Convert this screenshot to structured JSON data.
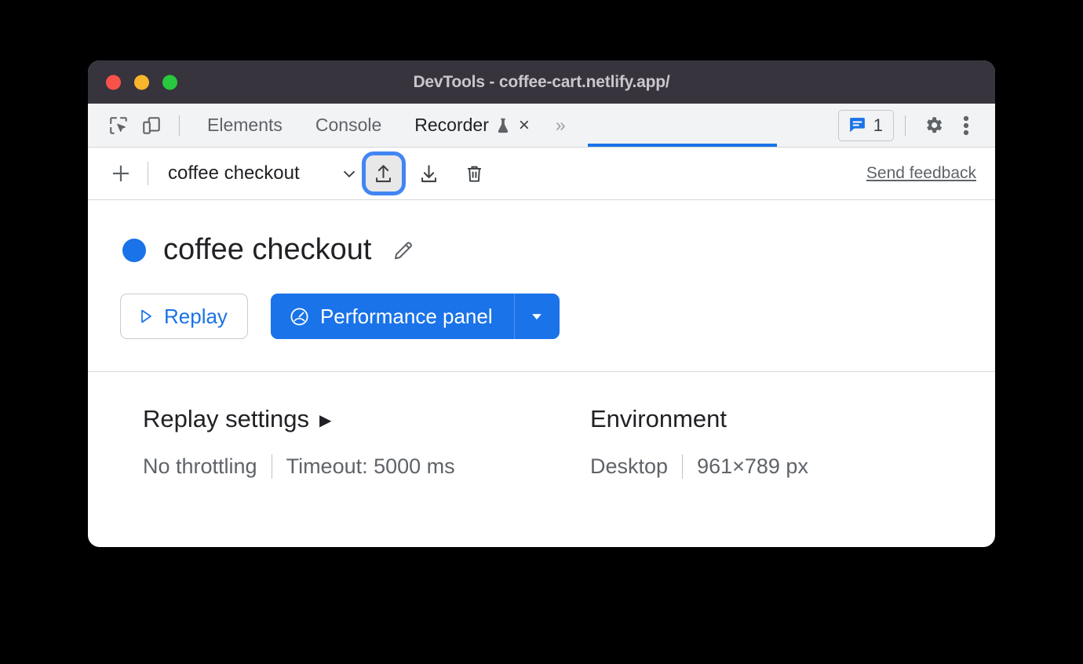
{
  "window": {
    "title": "DevTools - coffee-cart.netlify.app/",
    "traffic_lights": [
      "close",
      "minimize",
      "maximize"
    ]
  },
  "tabbar": {
    "left_icons": [
      {
        "name": "inspect-element-icon"
      },
      {
        "name": "device-toolbar-icon"
      }
    ],
    "tabs": [
      {
        "label": "Elements",
        "active": false
      },
      {
        "label": "Console",
        "active": false
      },
      {
        "label": "Recorder",
        "active": true,
        "experimental": true,
        "closable": true
      }
    ],
    "tab_close_glyph": "×",
    "overflow_glyph": "»",
    "issues_count": "1",
    "right_icons": [
      {
        "name": "settings-gear-icon"
      },
      {
        "name": "more-options-icon"
      }
    ],
    "active_tab_accent": "#1a73e8"
  },
  "recorder_toolbar": {
    "add_recording_label": "+",
    "recording_name": "coffee checkout",
    "chevron_glyph": "⌄",
    "buttons": [
      {
        "name": "export-recording",
        "highlighted": true
      },
      {
        "name": "import-recording",
        "highlighted": false
      },
      {
        "name": "delete-recording",
        "highlighted": false
      }
    ],
    "feedback_label": "Send feedback",
    "highlight_ring_color": "#4285f4",
    "highlight_fill_color": "#e8e8e8"
  },
  "recording": {
    "status_color": "#1a73e8",
    "title": "coffee checkout",
    "edit_icon": "pencil-icon"
  },
  "actions": {
    "replay_label": "Replay",
    "replay_icon": "play-triangle-icon",
    "performance_label": "Performance panel",
    "performance_icon": "speedometer-icon",
    "performance_caret": "▼",
    "primary_color": "#1a73e8"
  },
  "settings": {
    "replay": {
      "heading": "Replay settings",
      "expander_glyph": "▶",
      "values": [
        "No throttling",
        "Timeout: 5000 ms"
      ]
    },
    "environment": {
      "heading": "Environment",
      "values": [
        "Desktop",
        "961×789 px"
      ]
    }
  }
}
